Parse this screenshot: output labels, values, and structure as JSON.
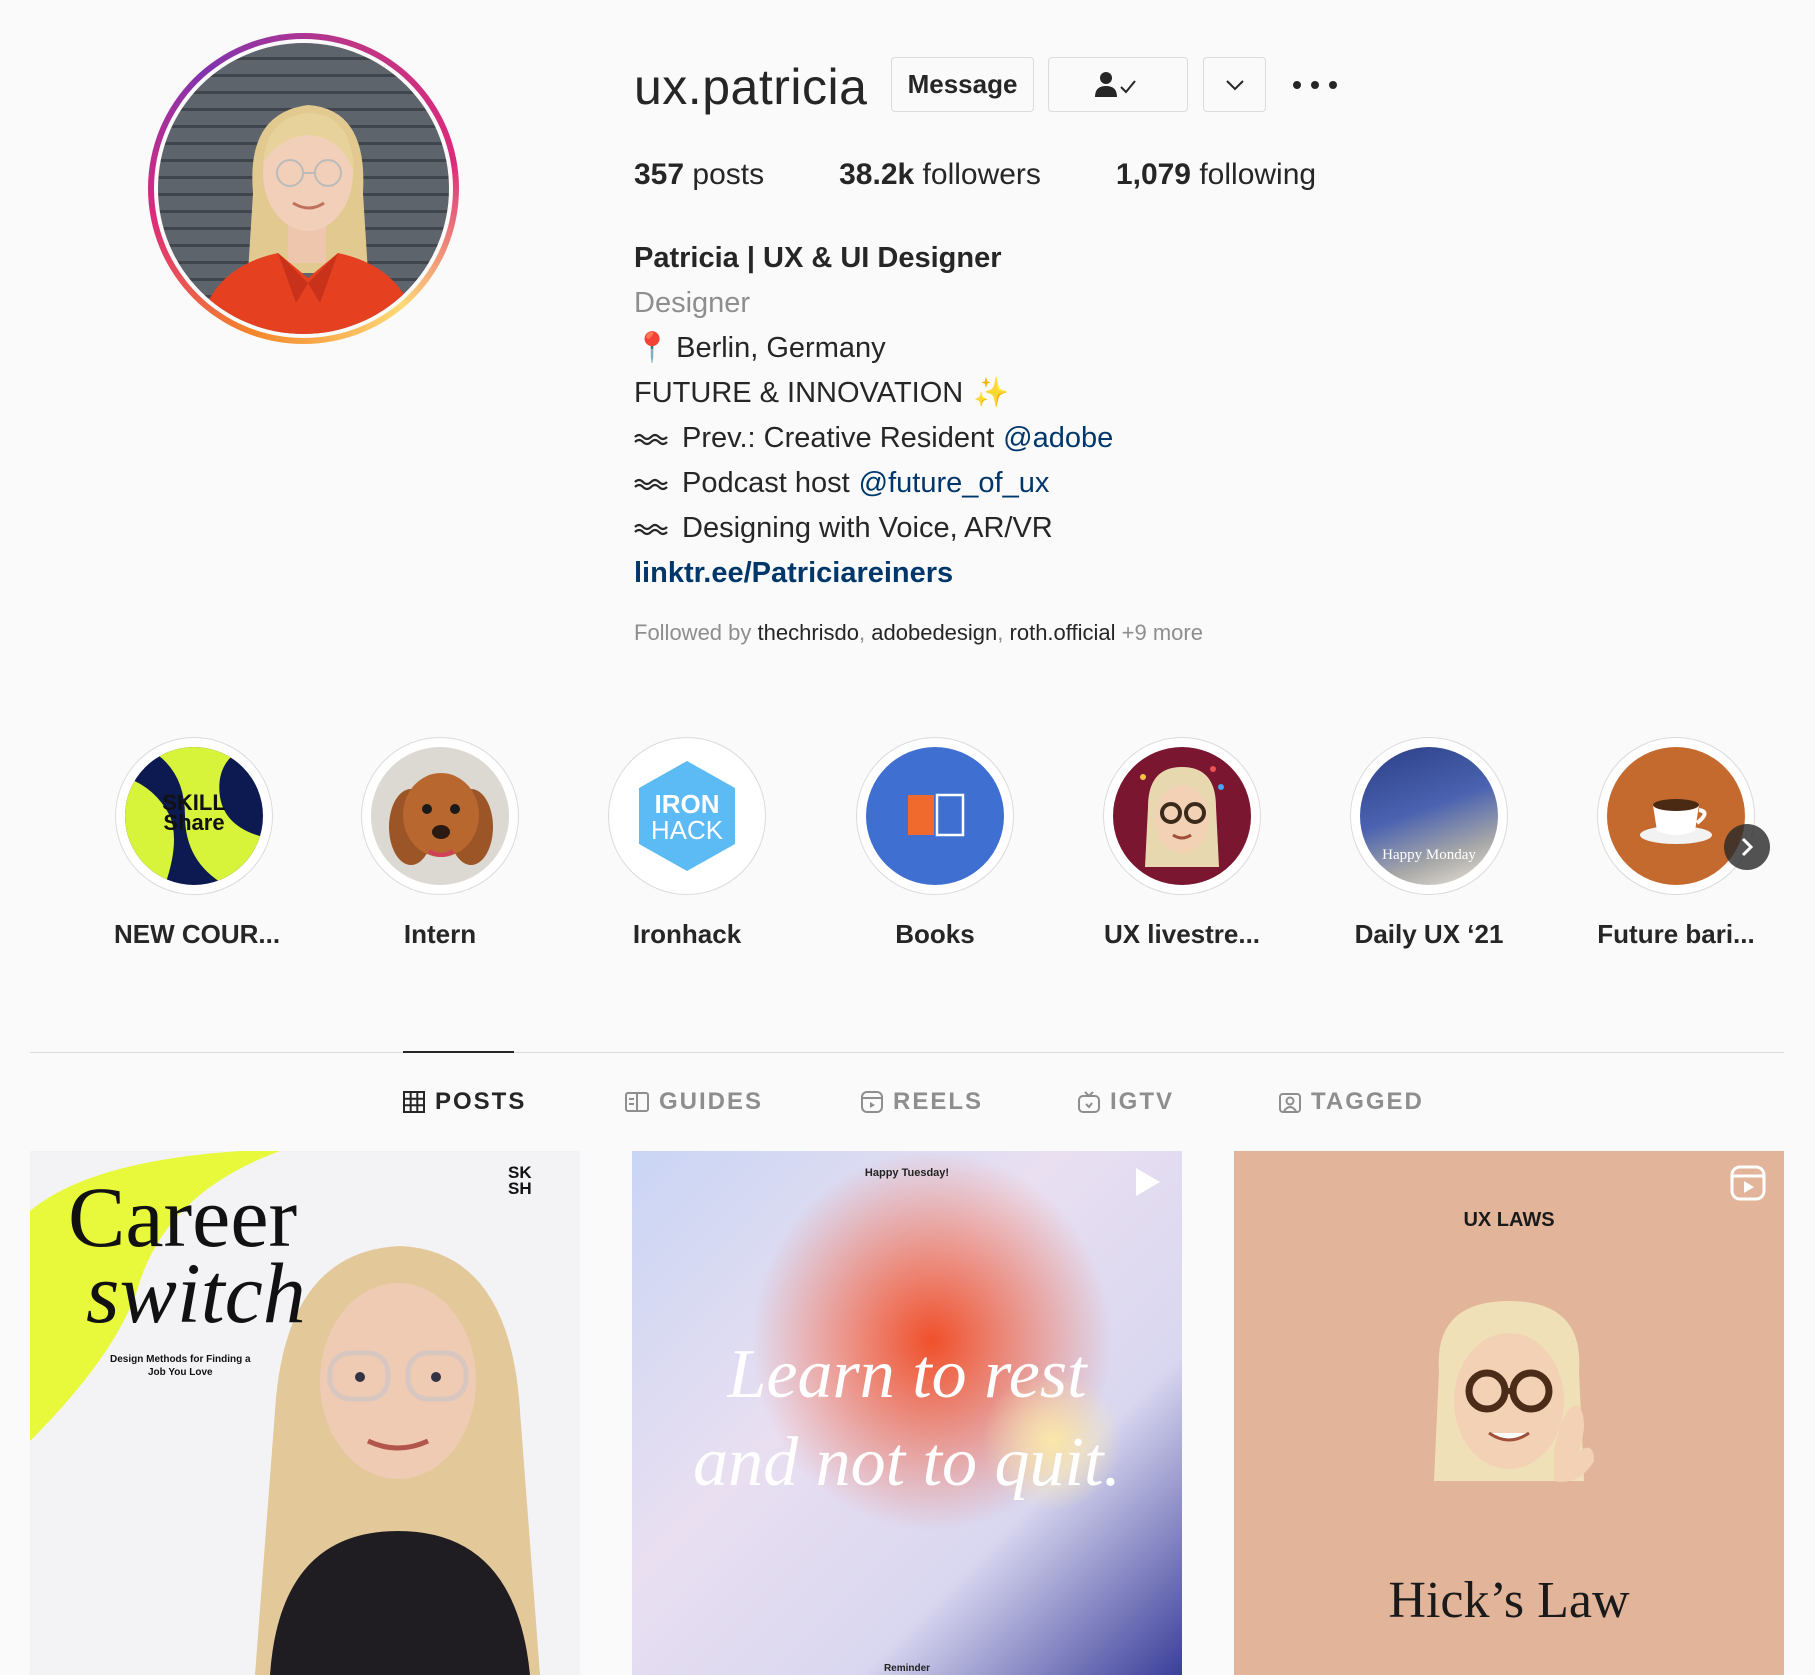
{
  "profile": {
    "username": "ux.patricia",
    "message_button": "Message"
  },
  "stats": [
    {
      "value": "357",
      "label": "posts"
    },
    {
      "value": "38.2k",
      "label": "followers"
    },
    {
      "value": "1,079",
      "label": "following"
    }
  ],
  "bio": {
    "name": "Patricia | UX & UI Designer",
    "category": "Designer",
    "location_emoji": "📍",
    "location": "Berlin, Germany",
    "tagline": "FUTURE & INNOVATION",
    "tagline_emoji": "✨",
    "lines": [
      {
        "text": "Prev.: Creative Resident",
        "mention": "@adobe"
      },
      {
        "text": "Podcast host",
        "mention": "@future_of_ux"
      },
      {
        "text": "Designing with Voice, AR/VR",
        "mention": ""
      }
    ],
    "link": "linktr.ee/Patriciareiners"
  },
  "followed_by": {
    "prefix": "Followed by",
    "accounts": [
      "thechrisdo",
      "adobedesign",
      "roth.official"
    ],
    "more": "+9 more"
  },
  "highlights": [
    {
      "label": "NEW COUR...",
      "icon": "skillshare-logo"
    },
    {
      "label": "Intern",
      "icon": "dog-photo"
    },
    {
      "label": "Ironhack",
      "icon": "ironhack-logo"
    },
    {
      "label": "Books",
      "icon": "book-icon"
    },
    {
      "label": "UX livestre...",
      "icon": "memoji-party"
    },
    {
      "label": "Daily UX ‘21",
      "icon": "office-photo"
    },
    {
      "label": "Future bari...",
      "icon": "coffee-icon"
    }
  ],
  "highlight_texts": {
    "skillshare_line1": "SKILL",
    "skillshare_line2": "Share",
    "ironhack_line1": "IRON",
    "ironhack_line2": "HACK",
    "office_caption": "Happy Monday"
  },
  "tabs": [
    {
      "label": "POSTS",
      "active": true,
      "icon": "grid-icon"
    },
    {
      "label": "GUIDES",
      "active": false,
      "icon": "guides-icon"
    },
    {
      "label": "REELS",
      "active": false,
      "icon": "reels-icon"
    },
    {
      "label": "IGTV",
      "active": false,
      "icon": "igtv-icon"
    },
    {
      "label": "TAGGED",
      "active": false,
      "icon": "tagged-icon"
    }
  ],
  "posts": [
    {
      "title_line1": "Career",
      "title_line2": "switch",
      "subtitle_line1": "Design Methods for Finding a",
      "subtitle_line2": "Job You Love",
      "brand_line1": "SK",
      "brand_line2": "SH",
      "overlay_icon": ""
    },
    {
      "header": "Happy Tuesday!",
      "line1": "Learn to rest",
      "line2": "and not to quit.",
      "footer": "Reminder",
      "overlay_icon": "play-icon"
    },
    {
      "header": "UX LAWS",
      "title": "Hick’s Law",
      "overlay_icon": "reels-icon"
    }
  ],
  "colors": {
    "link": "#00376b",
    "secondary_text": "#8e8e8e",
    "border": "#dbdbdb",
    "skillshare_yellow": "#d7f33a",
    "books_blue": "#3f6fd1",
    "memoji_bg": "#7a1630",
    "coffee_bg": "#c56a2e"
  }
}
